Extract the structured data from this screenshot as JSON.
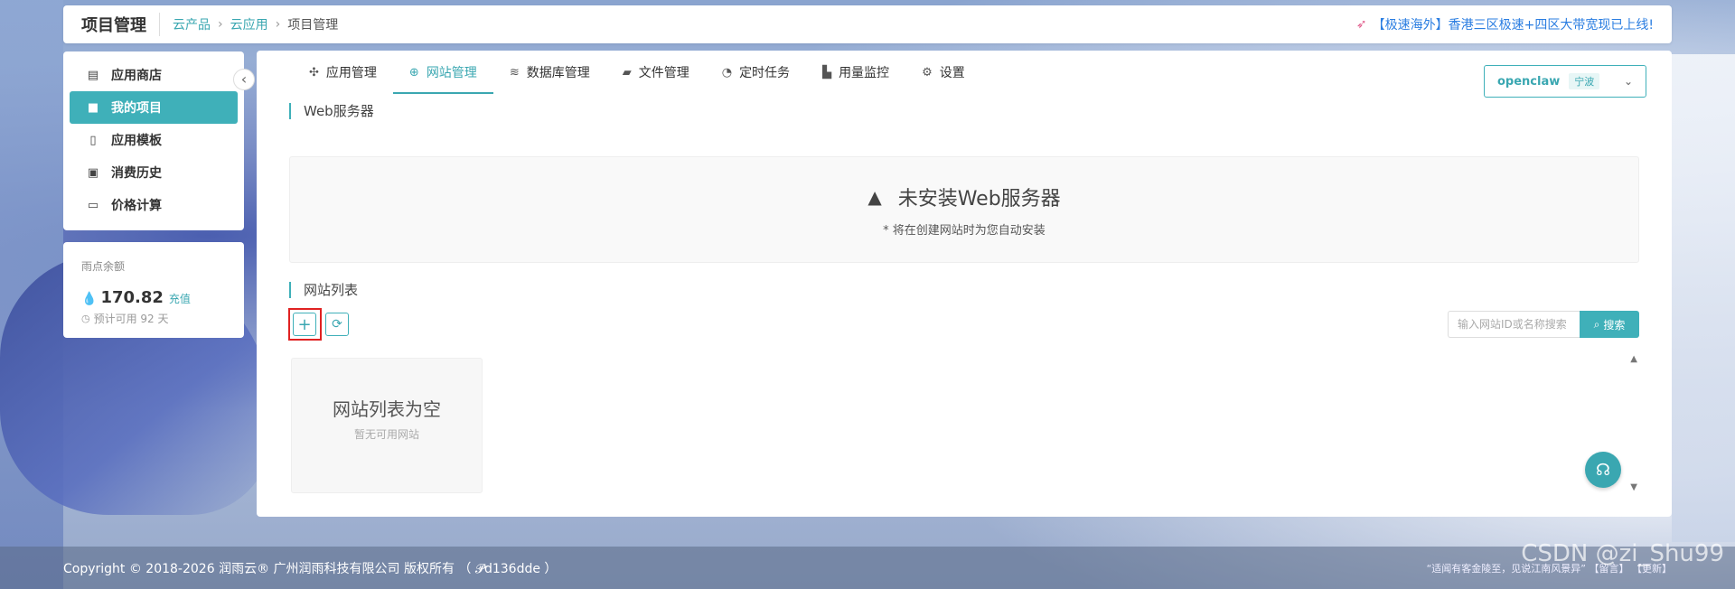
{
  "header": {
    "title": "项目管理",
    "breadcrumb": [
      "云产品",
      "云应用",
      "项目管理"
    ],
    "announcement": "【极速海外】香港三区极速+四区大带宽现已上线!"
  },
  "sidebar": {
    "items": [
      {
        "label": "应用商店",
        "icon": "store-icon"
      },
      {
        "label": "我的项目",
        "icon": "folder-icon",
        "active": true
      },
      {
        "label": "应用模板",
        "icon": "template-file-icon"
      },
      {
        "label": "消费历史",
        "icon": "money-icon"
      },
      {
        "label": "价格计算",
        "icon": "calculator-card-icon"
      }
    ],
    "collapse_glyph": "‹"
  },
  "balance": {
    "label": "雨点余额",
    "amount": "170.82",
    "recharge": "充值",
    "estimate": "预计可用 92 天"
  },
  "tabs": [
    {
      "label": "应用管理",
      "icon": "apps-icon"
    },
    {
      "label": "网站管理",
      "icon": "globe-icon",
      "active": true
    },
    {
      "label": "数据库管理",
      "icon": "database-icon"
    },
    {
      "label": "文件管理",
      "icon": "folder-open-icon"
    },
    {
      "label": "定时任务",
      "icon": "clock-icon"
    },
    {
      "label": "用量监控",
      "icon": "chart-icon"
    },
    {
      "label": "设置",
      "icon": "gear-icon"
    }
  ],
  "app_select": {
    "name": "openclaw",
    "region": "宁波"
  },
  "web_server": {
    "section_title": "Web服务器",
    "status": "未安装Web服务器",
    "note": "*   将在创建网站时为您自动安装"
  },
  "site_list": {
    "section_title": "网站列表",
    "search_placeholder": "输入网站ID或名称搜索",
    "search_button": "搜索",
    "empty_title": "网站列表为空",
    "empty_sub": "暂无可用网站"
  },
  "footer": {
    "copyright": "Copyright © 2018-2026 润雨云® 广州润雨科技有限公司 版权所有 （ 𝓟d136dde ）",
    "right_text": "“适闻有客金陵至，见说江南风景异”   【留言】   【更新】"
  },
  "watermark": "CSDN @zi_Shu99",
  "colors": {
    "accent": "#3fb0b9",
    "highlight": "#e02222"
  }
}
